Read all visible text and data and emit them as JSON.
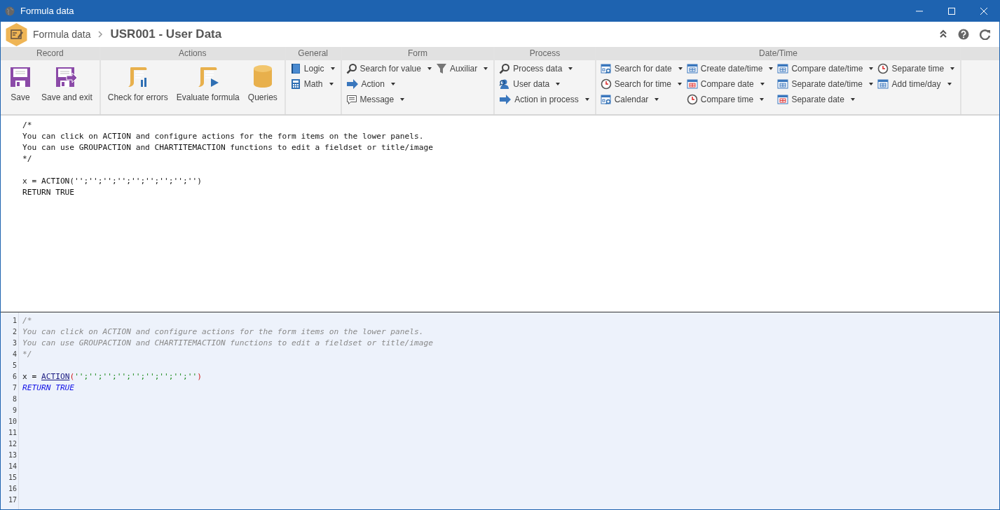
{
  "window": {
    "title": "Formula data"
  },
  "header": {
    "breadcrumb": "Formula data",
    "title": "USR001 - User Data"
  },
  "ribbon": {
    "groups": [
      {
        "title": "Record",
        "large_buttons": [
          {
            "label": "Save"
          },
          {
            "label": "Save and exit"
          }
        ]
      },
      {
        "title": "Actions",
        "large_buttons": [
          {
            "label": "Check for errors"
          },
          {
            "label": "Evaluate formula"
          },
          {
            "label": "Queries"
          }
        ]
      },
      {
        "title": "General",
        "columns": [
          [
            {
              "label": "Logic",
              "dropdown": true
            },
            {
              "label": "Math",
              "dropdown": true
            }
          ]
        ]
      },
      {
        "title": "Form",
        "columns": [
          [
            {
              "label": "Search for value",
              "dropdown": true
            },
            {
              "label": "Action",
              "dropdown": true
            },
            {
              "label": "Message",
              "dropdown": true
            }
          ],
          [
            {
              "label": "Auxiliar",
              "dropdown": true
            }
          ]
        ]
      },
      {
        "title": "Process",
        "columns": [
          [
            {
              "label": "Process data",
              "dropdown": true
            },
            {
              "label": "User data",
              "dropdown": true
            },
            {
              "label": "Action in process",
              "dropdown": true
            }
          ]
        ]
      },
      {
        "title": "Date/Time",
        "columns": [
          [
            {
              "label": "Search for date",
              "dropdown": true
            },
            {
              "label": "Search for time",
              "dropdown": true
            },
            {
              "label": "Calendar",
              "dropdown": true
            }
          ],
          [
            {
              "label": "Create date/time",
              "dropdown": true
            },
            {
              "label": "Compare date",
              "dropdown": true
            },
            {
              "label": "Compare time",
              "dropdown": true
            }
          ],
          [
            {
              "label": "Compare date/time",
              "dropdown": true
            },
            {
              "label": "Separate date/time",
              "dropdown": true
            },
            {
              "label": "Separate date",
              "dropdown": true
            }
          ],
          [
            {
              "label": "Separate time",
              "dropdown": true
            },
            {
              "label": "Add time/day",
              "dropdown": true
            }
          ]
        ]
      }
    ]
  },
  "preview": {
    "text": "/*\nYou can click on ACTION and configure actions for the form items on the lower panels.\nYou can use GROUPACTION and CHARTITEMACTION functions to edit a fieldset or title/image\n*/\n\nx = ACTION('';'';'';'';'';'';'';'';'')\nRETURN TRUE"
  },
  "editor": {
    "lines": [
      {
        "number": "1",
        "tokens": [
          {
            "kind": "comment",
            "text": "/*"
          }
        ]
      },
      {
        "number": "2",
        "tokens": [
          {
            "kind": "comment",
            "text": "You can click on ACTION and configure actions for the form items on the lower panels."
          }
        ]
      },
      {
        "number": "3",
        "tokens": [
          {
            "kind": "comment",
            "text": "You can use GROUPACTION and CHARTITEMACTION functions to edit a fieldset or title/image"
          }
        ]
      },
      {
        "number": "4",
        "tokens": [
          {
            "kind": "comment",
            "text": "*/"
          }
        ]
      },
      {
        "number": "5"
      },
      {
        "number": "6",
        "tokens": [
          {
            "kind": "plain",
            "text": "x = "
          },
          {
            "kind": "function",
            "text": "ACTION"
          },
          {
            "kind": "paren",
            "text": "("
          },
          {
            "kind": "string",
            "text": "'';'';'';'';'';'';'';'';''"
          },
          {
            "kind": "paren",
            "text": ")"
          }
        ]
      },
      {
        "number": "7",
        "tokens": [
          {
            "kind": "keyword",
            "text": "RETURN TRUE"
          }
        ]
      },
      {
        "number": "8"
      },
      {
        "number": "9"
      },
      {
        "number": "10"
      },
      {
        "number": "11"
      },
      {
        "number": "12"
      },
      {
        "number": "13"
      },
      {
        "number": "14"
      },
      {
        "number": "15"
      },
      {
        "number": "16"
      },
      {
        "number": "17"
      }
    ]
  }
}
